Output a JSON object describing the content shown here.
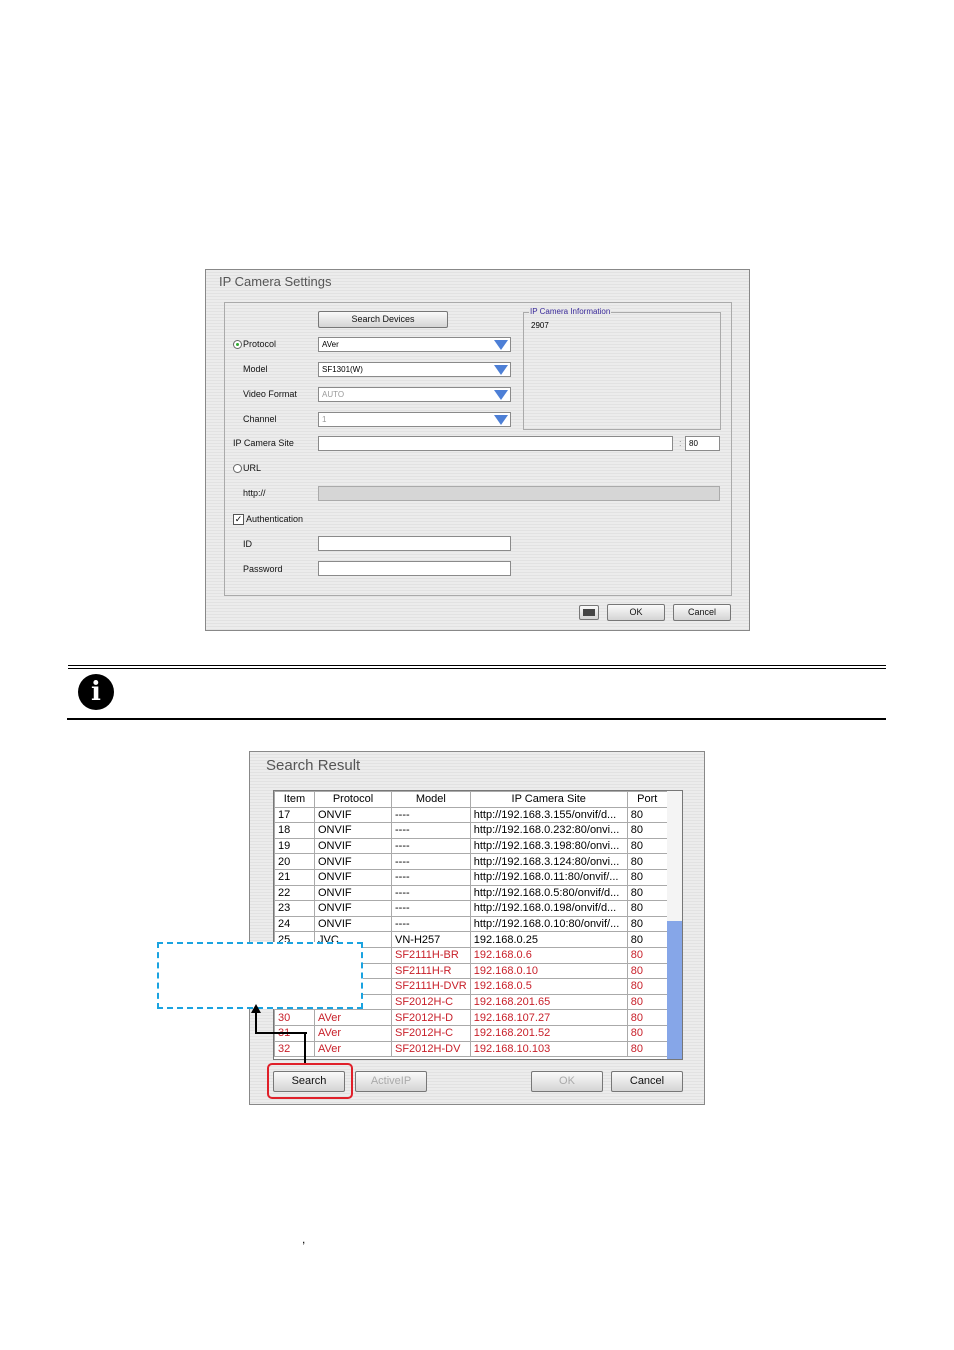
{
  "settings": {
    "title": "IP Camera Settings",
    "search_devices": "Search Devices",
    "protocol_label": "Protocol",
    "protocol_value": "AVer",
    "model_label": "Model",
    "model_value": "SF1301(W)",
    "video_format_label": "Video Format",
    "video_format_value": "AUTO",
    "channel_label": "Channel",
    "channel_value": "1",
    "site_label": "IP Camera Site",
    "site_value": "",
    "port_sep": ":",
    "port_value": "80",
    "url_label": "URL",
    "http_label": "http://",
    "auth_label": "Authentication",
    "auth_checked": true,
    "id_label": "ID",
    "password_label": "Password",
    "info_legend": "IP Camera Information",
    "info_value": "2907",
    "ok": "OK",
    "cancel": "Cancel"
  },
  "note": {
    "icon": "info-icon"
  },
  "search": {
    "title": "Search Result",
    "columns": [
      "Item",
      "Protocol",
      "Model",
      "IP Camera Site",
      "Port"
    ],
    "rows": [
      {
        "item": "17",
        "protocol": "ONVIF",
        "model": "----",
        "site": "http://192.168.3.155/onvif/d...",
        "port": "80",
        "red": false
      },
      {
        "item": "18",
        "protocol": "ONVIF",
        "model": "----",
        "site": "http://192.168.0.232:80/onvi...",
        "port": "80",
        "red": false
      },
      {
        "item": "19",
        "protocol": "ONVIF",
        "model": "----",
        "site": "http://192.168.3.198:80/onvi...",
        "port": "80",
        "red": false
      },
      {
        "item": "20",
        "protocol": "ONVIF",
        "model": "----",
        "site": "http://192.168.3.124:80/onvi...",
        "port": "80",
        "red": false
      },
      {
        "item": "21",
        "protocol": "ONVIF",
        "model": "----",
        "site": "http://192.168.0.11:80/onvif/...",
        "port": "80",
        "red": false
      },
      {
        "item": "22",
        "protocol": "ONVIF",
        "model": "----",
        "site": "http://192.168.0.5:80/onvif/d...",
        "port": "80",
        "red": false
      },
      {
        "item": "23",
        "protocol": "ONVIF",
        "model": "----",
        "site": "http://192.168.0.198/onvif/d...",
        "port": "80",
        "red": false
      },
      {
        "item": "24",
        "protocol": "ONVIF",
        "model": "----",
        "site": "http://192.168.0.10:80/onvif/...",
        "port": "80",
        "red": false
      },
      {
        "item": "25",
        "protocol": "JVC",
        "model": "VN-H257",
        "site": "192.168.0.25",
        "port": "80",
        "red": false
      },
      {
        "item": "",
        "protocol": "",
        "model": "SF2111H-BR",
        "site": "192.168.0.6",
        "port": "80",
        "red": true
      },
      {
        "item": "",
        "protocol": "",
        "model": "SF2111H-R",
        "site": "192.168.0.10",
        "port": "80",
        "red": true
      },
      {
        "item": "",
        "protocol": "",
        "model": "SF2111H-DVR",
        "site": "192.168.0.5",
        "port": "80",
        "red": true
      },
      {
        "item": "",
        "protocol": "",
        "model": "SF2012H-C",
        "site": "192.168.201.65",
        "port": "80",
        "red": true
      },
      {
        "item": "30",
        "protocol": "AVer",
        "model": "SF2012H-D",
        "site": "192.168.107.27",
        "port": "80",
        "red": true
      },
      {
        "item": "31",
        "protocol": "AVer",
        "model": "SF2012H-C",
        "site": "192.168.201.52",
        "port": "80",
        "red": true
      },
      {
        "item": "32",
        "protocol": "AVer",
        "model": "SF2012H-DV",
        "site": "192.168.10.103",
        "port": "80",
        "red": true
      }
    ],
    "search_btn": "Search",
    "activeip_btn": "ActiveIP",
    "ok_btn": "OK",
    "cancel_btn": "Cancel"
  },
  "footer_mark": ","
}
